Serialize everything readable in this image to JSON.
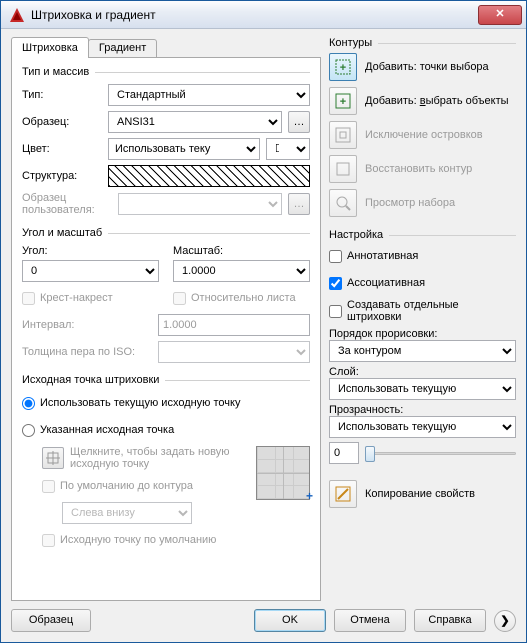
{
  "window": {
    "title": "Штриховка и градиент"
  },
  "tabs": {
    "hatch": "Штриховка",
    "gradient": "Градиент"
  },
  "type_group": {
    "title": "Тип и массив",
    "type_label": "Тип:",
    "type_value": "Стандартный",
    "pattern_label": "Образец:",
    "pattern_value": "ANSI31",
    "color_label": "Цвет:",
    "color_value": "Использовать теку",
    "structure_label": "Структура:",
    "custom_label": "Образец пользователя:"
  },
  "angle_group": {
    "title": "Угол и масштаб",
    "angle_label": "Угол:",
    "angle_value": "0",
    "scale_label": "Масштаб:",
    "scale_value": "1.0000",
    "cross_label": "Крест-накрест",
    "relative_label": "Относительно листа",
    "interval_label": "Интервал:",
    "interval_value": "1.0000",
    "iso_label": "Толщина пера по ISO:"
  },
  "origin_group": {
    "title": "Исходная точка штриховки",
    "use_current": "Использовать текущую исходную точку",
    "specified": "Указанная исходная точка",
    "click_hint": "Щелкните, чтобы задать новую исходную точку",
    "default_to": "По умолчанию до контура",
    "position": "Слева внизу",
    "store_default": "Исходную точку по умолчанию"
  },
  "boundaries": {
    "title": "Контуры",
    "add_pick": "Добавить: точки выбора",
    "add_select": "Добавить: выбрать объекты",
    "exclude": "Исключение островков",
    "recreate": "Восстановить контур",
    "view": "Просмотр набора"
  },
  "settings": {
    "title": "Настройка",
    "annotative": "Аннотативная",
    "associative": "Ассоциативная",
    "separate": "Создавать отдельные штриховки",
    "draw_order_label": "Порядок прорисовки:",
    "draw_order_value": "За контуром",
    "layer_label": "Слой:",
    "layer_value": "Использовать текущую",
    "transparency_label": "Прозрачность:",
    "transparency_value": "Использовать текущую",
    "transparency_num": "0"
  },
  "inherit": "Копирование свойств",
  "footer": {
    "preview": "Образец",
    "ok": "OK",
    "cancel": "Отмена",
    "help": "Справка"
  }
}
